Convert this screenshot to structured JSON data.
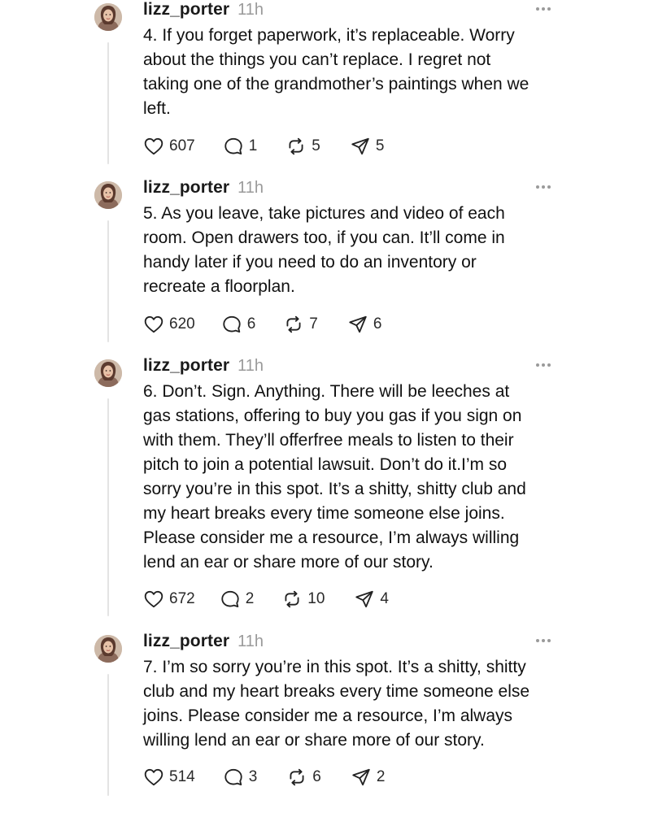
{
  "posts": [
    {
      "username": "lizz_porter",
      "time": "11h",
      "text": "4. If you forget paperwork, it’s replaceable. Worry\nabout the things you can’t replace. I regret not\ntaking one of the grandmother’s paintings when we\nleft.",
      "likes": "607",
      "replies": "1",
      "reposts": "5",
      "shares": "5"
    },
    {
      "username": "lizz_porter",
      "time": "11h",
      "text": "5. As you leave, take pictures and video of each\nroom. Open drawers too, if you can. It’ll come in\nhandy later if you need to do an inventory or\nrecreate a floorplan.",
      "likes": "620",
      "replies": "6",
      "reposts": "7",
      "shares": "6"
    },
    {
      "username": "lizz_porter",
      "time": "11h",
      "text": "6. Don’t. Sign. Anything. There will be leeches at\ngas stations, offering to buy you gas if you sign on\nwith them. They’ll offerfree meals to listen to their\npitch to join a potential lawsuit. Don’t do it.I’m so\nsorry you’re in this spot. It’s a shitty, shitty club and\nmy heart breaks every time someone else joins.\nPlease consider me a resource, I’m always willing\nlend an ear or share more of our story.",
      "likes": "672",
      "replies": "2",
      "reposts": "10",
      "shares": "4"
    },
    {
      "username": "lizz_porter",
      "time": "11h",
      "text": "7. I’m so sorry you’re in this spot. It’s a shitty, shitty\nclub and my heart breaks every time someone else\njoins. Please consider me a resource, I’m always\nwilling lend an ear or share more of our story.",
      "likes": "514",
      "replies": "3",
      "reposts": "6",
      "shares": "2"
    }
  ],
  "icons": {
    "like": "heart-icon",
    "reply": "reply-bubble-icon",
    "repost": "repost-icon",
    "share": "share-send-icon",
    "more": "more-dots-icon"
  }
}
